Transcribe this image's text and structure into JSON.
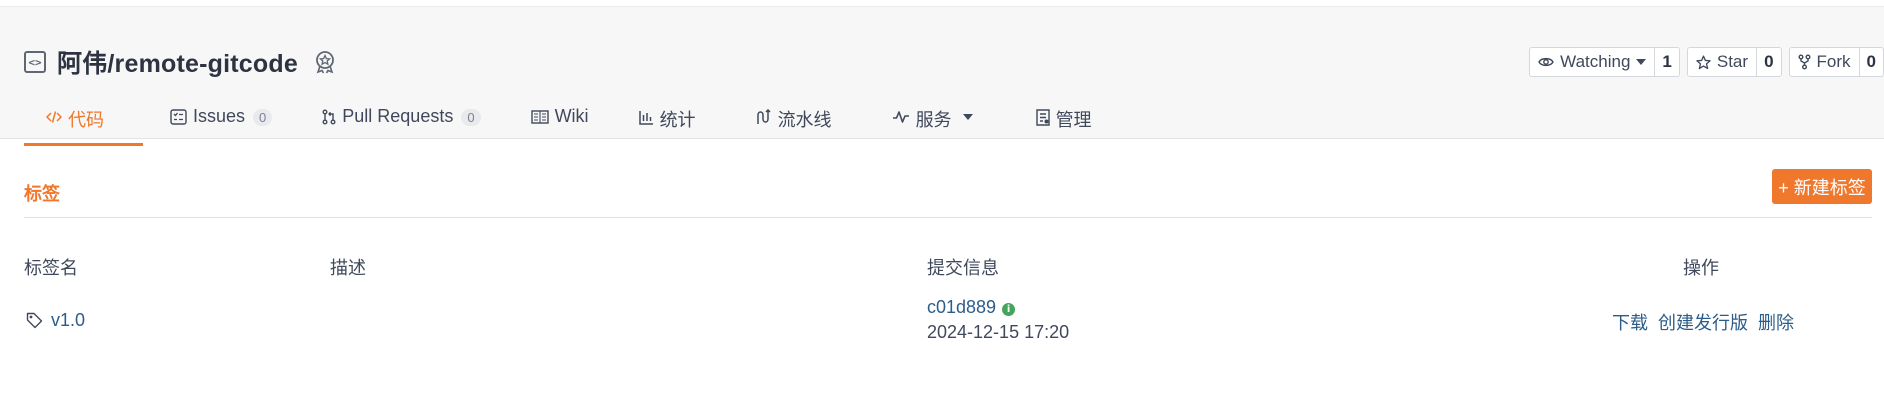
{
  "repo": {
    "title": "阿伟/remote-gitcode"
  },
  "actions": {
    "watch": {
      "label": "Watching",
      "count": "1"
    },
    "star": {
      "label": "Star",
      "count": "0"
    },
    "fork": {
      "label": "Fork",
      "count": "0"
    }
  },
  "tabs": [
    {
      "label": "代码"
    },
    {
      "label": "Issues",
      "count": "0"
    },
    {
      "label": "Pull Requests",
      "count": "0"
    },
    {
      "label": "Wiki"
    },
    {
      "label": "统计"
    },
    {
      "label": "流水线"
    },
    {
      "label": "服务"
    },
    {
      "label": "管理"
    }
  ],
  "section": {
    "title": "标签",
    "new_button": "+ 新建标签"
  },
  "table": {
    "headers": {
      "name": "标签名",
      "desc": "描述",
      "commit": "提交信息",
      "ops": "操作"
    },
    "rows": [
      {
        "name": "v1.0",
        "desc": "",
        "commit": "c01d889",
        "date": "2024-12-15 17:20",
        "ops": {
          "download": "下载",
          "release": "创建发行版",
          "delete": "删除"
        }
      }
    ]
  },
  "colors": {
    "accent": "#f0782d",
    "link": "#2c5d8a",
    "status_green": "#45a55a"
  }
}
